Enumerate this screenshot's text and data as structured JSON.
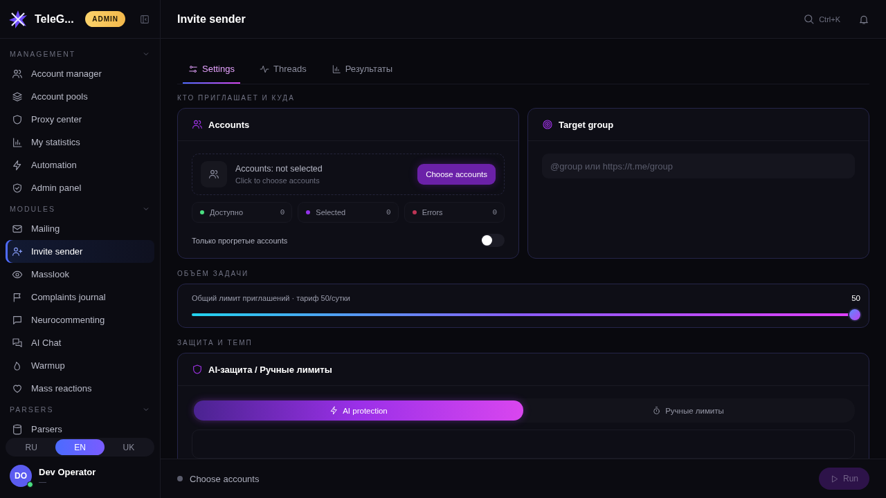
{
  "brand": {
    "name": "TeleG...",
    "badge": "ADMIN"
  },
  "sidebar": {
    "sections": [
      {
        "title": "MANAGEMENT",
        "expanded": true,
        "items": [
          {
            "label": "Account manager",
            "selected": false
          },
          {
            "label": "Account pools",
            "selected": false
          },
          {
            "label": "Proxy center",
            "selected": false
          },
          {
            "label": "My statistics",
            "selected": false
          },
          {
            "label": "Automation",
            "selected": false
          },
          {
            "label": "Admin panel",
            "selected": false
          }
        ]
      },
      {
        "title": "MODULES",
        "expanded": true,
        "items": [
          {
            "label": "Mailing",
            "selected": false
          },
          {
            "label": "Invite sender",
            "selected": true
          },
          {
            "label": "Masslook",
            "selected": false
          },
          {
            "label": "Complaints journal",
            "selected": false
          },
          {
            "label": "Neurocommenting",
            "selected": false
          },
          {
            "label": "AI Chat",
            "selected": false
          },
          {
            "label": "Warmup",
            "selected": false
          },
          {
            "label": "Mass reactions",
            "selected": false
          }
        ]
      },
      {
        "title": "PARSERS",
        "expanded": true,
        "items": [
          {
            "label": "Parsers",
            "selected": false
          }
        ]
      }
    ]
  },
  "languages": [
    {
      "label": "RU",
      "selected": false
    },
    {
      "label": "EN",
      "selected": true
    },
    {
      "label": "UK",
      "selected": false
    }
  ],
  "user": {
    "initials": "DO",
    "name": "Dev Operator",
    "subtitle": "—",
    "online": true
  },
  "header": {
    "title": "Invite sender",
    "search_hint": "Ctrl+K"
  },
  "tabs": [
    {
      "label": "Settings",
      "selected": true
    },
    {
      "label": "Threads",
      "selected": false
    },
    {
      "label": "Результаты",
      "selected": false
    }
  ],
  "section_who": "КТО ПРИГЛАШАЕТ И КУДА",
  "accounts_card": {
    "title": "Accounts",
    "status": "Accounts: not selected",
    "hint": "Click to choose accounts",
    "button": "Choose accounts",
    "stats": [
      {
        "label": "Доступно",
        "value": "0",
        "color": "#4ade80"
      },
      {
        "label": "Selected",
        "value": "0",
        "color": "#9333ea"
      },
      {
        "label": "Errors",
        "value": "0",
        "color": "#be3455"
      }
    ],
    "toggle": {
      "label": "Только прогретые accounts",
      "on": false
    }
  },
  "target_card": {
    "title": "Target group",
    "placeholder": "@group или https://t.me/group"
  },
  "section_volume": "ОБЪЁМ ЗАДАЧИ",
  "limit": {
    "label": "Общий лимит приглашений · тариф 50/сутки",
    "reading": "50",
    "level": 1
  },
  "section_protect": "ЗАЩИТА И ТЕМП",
  "protect_card": {
    "title": "AI-защита / Ручные лимиты",
    "modes": [
      {
        "label": "AI protection",
        "selected": true
      },
      {
        "label": "Ручные лимиты",
        "selected": false
      }
    ]
  },
  "footer": {
    "status": "Choose accounts",
    "run": {
      "label": "Run",
      "disabled": true
    }
  }
}
